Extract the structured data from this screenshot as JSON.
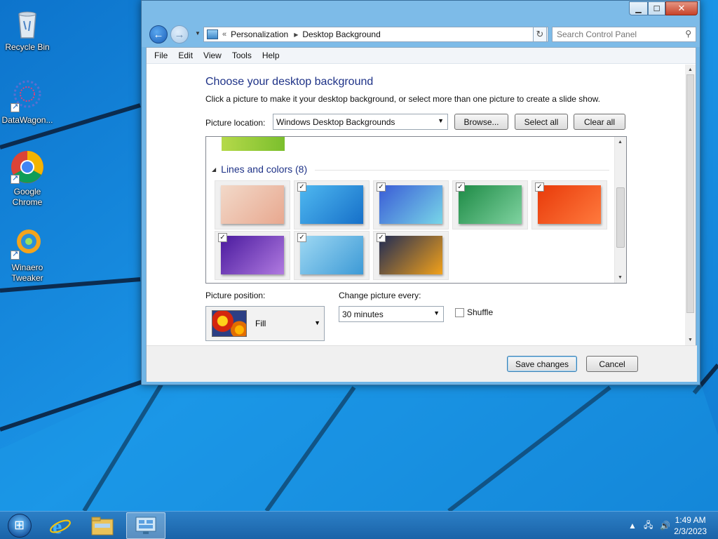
{
  "desktop": {
    "icons": [
      {
        "label": "Recycle Bin"
      },
      {
        "label": "DataWagon..."
      },
      {
        "label": "Google Chrome"
      },
      {
        "label": "Winaero Tweaker"
      }
    ]
  },
  "window": {
    "address": {
      "prefix": "«",
      "crumbs": [
        "Personalization",
        "Desktop Background"
      ]
    },
    "search": {
      "placeholder": "Search Control Panel"
    },
    "menu": [
      "File",
      "Edit",
      "View",
      "Tools",
      "Help"
    ],
    "heading": "Choose your desktop background",
    "subtext": "Click a picture to make it your desktop background, or select more than one picture to create a slide show.",
    "picture_location": {
      "label": "Picture location:",
      "value": "Windows Desktop Backgrounds",
      "browse": "Browse...",
      "select_all": "Select all",
      "clear_all": "Clear all"
    },
    "group": {
      "title": "Lines and colors (8)",
      "thumbnails": [
        {
          "checked": false,
          "colors": [
            "#f2d9c9",
            "#e8a88f"
          ]
        },
        {
          "checked": true,
          "colors": [
            "#4fb8f0",
            "#1670c9"
          ]
        },
        {
          "checked": true,
          "colors": [
            "#3a5bd6",
            "#78d6e8"
          ]
        },
        {
          "checked": true,
          "colors": [
            "#1d8a45",
            "#7fd3a0"
          ]
        },
        {
          "checked": true,
          "colors": [
            "#e83a0a",
            "#ff7a3d"
          ]
        },
        {
          "checked": true,
          "colors": [
            "#4a1a9e",
            "#b07ae0"
          ]
        },
        {
          "checked": true,
          "colors": [
            "#9ed8f3",
            "#3d9ad6"
          ]
        },
        {
          "checked": true,
          "colors": [
            "#1f2b55",
            "#f2a11a"
          ]
        }
      ]
    },
    "picture_position": {
      "label": "Picture position:",
      "value": "Fill"
    },
    "change_every": {
      "label": "Change picture every:",
      "value": "30 minutes"
    },
    "shuffle": {
      "label": "Shuffle",
      "checked": false
    },
    "buttons": {
      "save": "Save changes",
      "cancel": "Cancel"
    }
  },
  "taskbar": {
    "clock": {
      "time": "1:49 AM",
      "date": "2/3/2023"
    }
  }
}
